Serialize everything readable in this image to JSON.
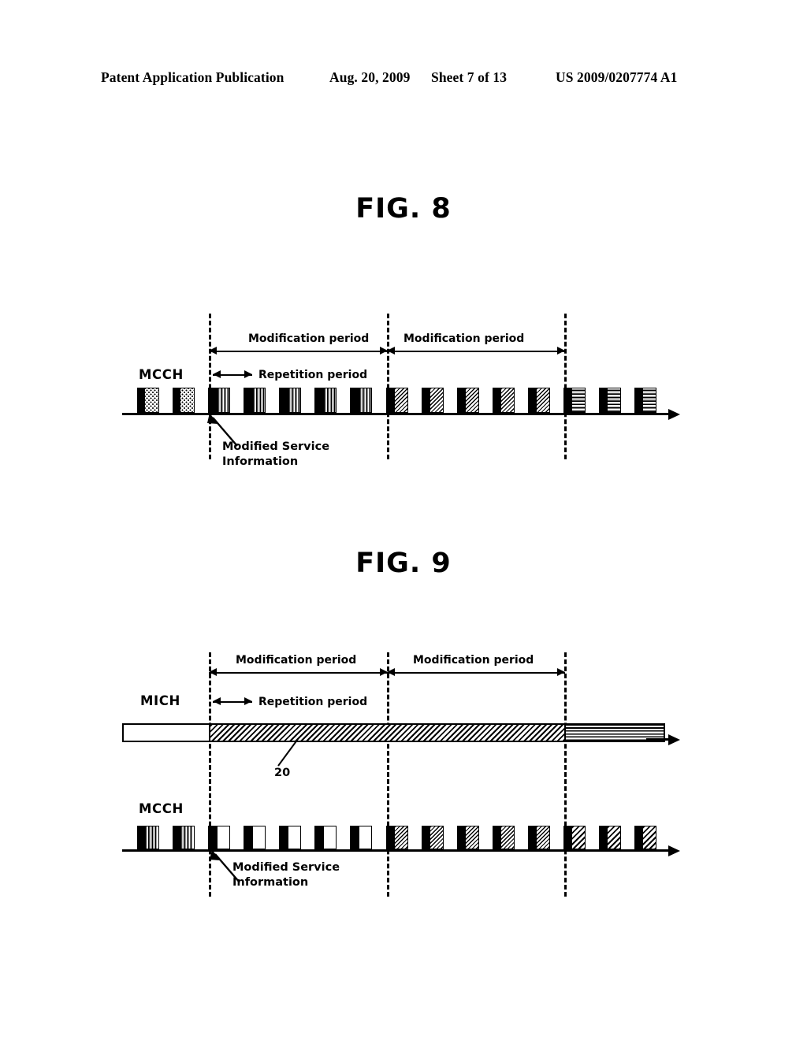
{
  "header": {
    "publication": "Patent Application Publication",
    "date": "Aug. 20, 2009",
    "sheet": "Sheet 7 of 13",
    "patent_number": "US 2009/0207774 A1"
  },
  "figures": [
    {
      "title": "FIG. 8",
      "channels": [
        {
          "label": "MCCH",
          "annotations": {
            "modification_period_1": "Modification period",
            "modification_period_2": "Modification period",
            "repetition_period": "Repetition period"
          },
          "callout": "Modified Service\nInformation"
        }
      ]
    },
    {
      "title": "FIG. 9",
      "channels": [
        {
          "label": "MICH",
          "annotations": {
            "modification_period_1": "Modification period",
            "modification_period_2": "Modification period",
            "repetition_period": "Repetition period"
          },
          "reference_numeral": "20"
        },
        {
          "label": "MCCH",
          "callout": "Modified Service\nInformation"
        }
      ]
    }
  ],
  "colors": {
    "ink": "#000000",
    "paper": "#ffffff",
    "pattern_gray": "#9a9a9a"
  }
}
